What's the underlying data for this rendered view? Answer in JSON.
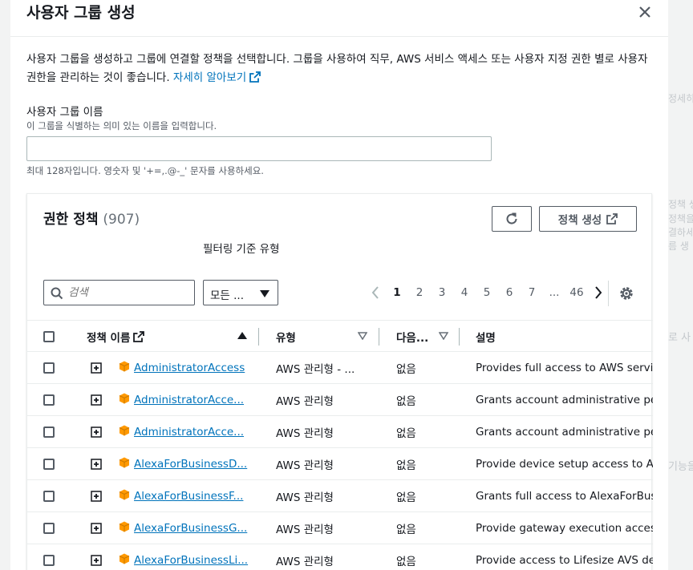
{
  "background": {
    "fragments": [
      "정세히",
      "정책 생",
      "정책을",
      "결하세",
      "름 생",
      "로 사",
      "기능을"
    ]
  },
  "modal": {
    "title": "사용자 그룹 생성",
    "description": "사용자 그룹을 생성하고 그룹에 연결할 정책을 선택합니다. 그룹을 사용하여 직무, AWS 서비스 액세스 또는 사용자 지정 권한 별로 사용자 권한을 관리하는 것이 좋습니다.",
    "learn_more": "자세히 알아보기"
  },
  "name_field": {
    "label": "사용자 그룹 이름",
    "description": "이 그룹을 식별하는 의미 있는 이름을 입력합니다.",
    "value": "",
    "constraint": "최대 128자입니다. 영숫자 및 '+=,.@-_' 문자를 사용하세요."
  },
  "policies": {
    "title": "권한 정책",
    "count": "(907)",
    "create_button": "정책 생성",
    "filter_label": "필터링 기준 유형",
    "search_placeholder": "검색",
    "filter_selected": "모든 ...",
    "pages": [
      "1",
      "2",
      "3",
      "4",
      "5",
      "6",
      "7",
      "...",
      "46"
    ],
    "current_page": "1",
    "columns": {
      "name": "정책 이름",
      "type": "유형",
      "used_as": "다음...",
      "description": "설명"
    },
    "rows": [
      {
        "name": "AdministratorAccess",
        "type": "AWS 관리형 - ...",
        "used_as": "없음",
        "description": "Provides full access to AWS services"
      },
      {
        "name": "AdministratorAcce...",
        "type": "AWS 관리형",
        "used_as": "없음",
        "description": "Grants account administrative perm"
      },
      {
        "name": "AdministratorAcce...",
        "type": "AWS 관리형",
        "used_as": "없음",
        "description": "Grants account administrative perm"
      },
      {
        "name": "AlexaForBusinessD...",
        "type": "AWS 관리형",
        "used_as": "없음",
        "description": "Provide device setup access to Alex"
      },
      {
        "name": "AlexaForBusinessF...",
        "type": "AWS 관리형",
        "used_as": "없음",
        "description": "Grants full access to AlexaForBusin"
      },
      {
        "name": "AlexaForBusinessG...",
        "type": "AWS 관리형",
        "used_as": "없음",
        "description": "Provide gateway execution access t"
      },
      {
        "name": "AlexaForBusinessLi...",
        "type": "AWS 관리형",
        "used_as": "없음",
        "description": "Provide access to Lifesize AVS devic"
      }
    ]
  },
  "colors": {
    "link": "#0073bb",
    "policy_icon": "#ff9900",
    "border": "#eaeded",
    "text": "#16191f",
    "muted": "#545b64"
  }
}
